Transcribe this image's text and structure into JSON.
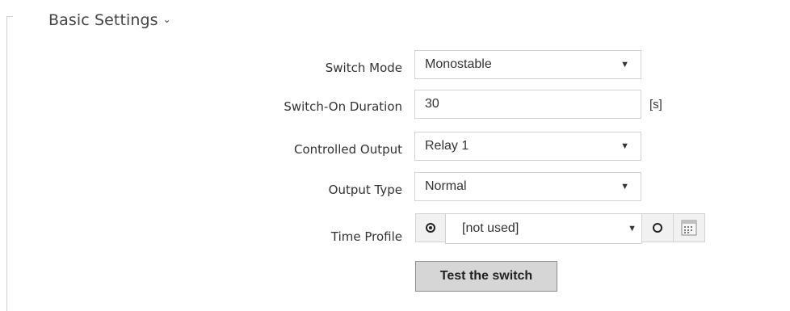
{
  "section": {
    "title": "Basic Settings",
    "chevron": "⌄"
  },
  "form": {
    "switch_mode": {
      "label": "Switch Mode",
      "value": "Monostable",
      "caret": "▼"
    },
    "switch_on_duration": {
      "label": "Switch-On Duration",
      "value": "30",
      "unit": "[s]"
    },
    "controlled_output": {
      "label": "Controlled Output",
      "value": "Relay 1",
      "caret": "▼"
    },
    "output_type": {
      "label": "Output Type",
      "value": "Normal",
      "caret": "▼"
    },
    "time_profile": {
      "label": "Time Profile",
      "value": "[not used]",
      "caret": "▼",
      "icons": [
        "radio-selected-icon",
        "radio-unselected-icon",
        "calendar-icon"
      ]
    },
    "test_button": {
      "label": "Test the switch"
    }
  },
  "colors": {
    "border": "#d2d2d2",
    "button_bg": "#d6d6d6",
    "text": "#333333"
  }
}
